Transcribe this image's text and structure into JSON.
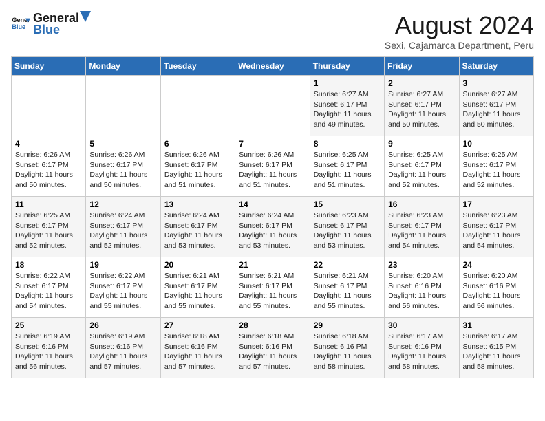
{
  "logo": {
    "line1": "General",
    "line2": "Blue"
  },
  "title": "August 2024",
  "location": "Sexi, Cajamarca Department, Peru",
  "days_of_week": [
    "Sunday",
    "Monday",
    "Tuesday",
    "Wednesday",
    "Thursday",
    "Friday",
    "Saturday"
  ],
  "weeks": [
    [
      {
        "day": "",
        "info": ""
      },
      {
        "day": "",
        "info": ""
      },
      {
        "day": "",
        "info": ""
      },
      {
        "day": "",
        "info": ""
      },
      {
        "day": "1",
        "info": "Sunrise: 6:27 AM\nSunset: 6:17 PM\nDaylight: 11 hours and 49 minutes."
      },
      {
        "day": "2",
        "info": "Sunrise: 6:27 AM\nSunset: 6:17 PM\nDaylight: 11 hours and 50 minutes."
      },
      {
        "day": "3",
        "info": "Sunrise: 6:27 AM\nSunset: 6:17 PM\nDaylight: 11 hours and 50 minutes."
      }
    ],
    [
      {
        "day": "4",
        "info": "Sunrise: 6:26 AM\nSunset: 6:17 PM\nDaylight: 11 hours and 50 minutes."
      },
      {
        "day": "5",
        "info": "Sunrise: 6:26 AM\nSunset: 6:17 PM\nDaylight: 11 hours and 50 minutes."
      },
      {
        "day": "6",
        "info": "Sunrise: 6:26 AM\nSunset: 6:17 PM\nDaylight: 11 hours and 51 minutes."
      },
      {
        "day": "7",
        "info": "Sunrise: 6:26 AM\nSunset: 6:17 PM\nDaylight: 11 hours and 51 minutes."
      },
      {
        "day": "8",
        "info": "Sunrise: 6:25 AM\nSunset: 6:17 PM\nDaylight: 11 hours and 51 minutes."
      },
      {
        "day": "9",
        "info": "Sunrise: 6:25 AM\nSunset: 6:17 PM\nDaylight: 11 hours and 52 minutes."
      },
      {
        "day": "10",
        "info": "Sunrise: 6:25 AM\nSunset: 6:17 PM\nDaylight: 11 hours and 52 minutes."
      }
    ],
    [
      {
        "day": "11",
        "info": "Sunrise: 6:25 AM\nSunset: 6:17 PM\nDaylight: 11 hours and 52 minutes."
      },
      {
        "day": "12",
        "info": "Sunrise: 6:24 AM\nSunset: 6:17 PM\nDaylight: 11 hours and 52 minutes."
      },
      {
        "day": "13",
        "info": "Sunrise: 6:24 AM\nSunset: 6:17 PM\nDaylight: 11 hours and 53 minutes."
      },
      {
        "day": "14",
        "info": "Sunrise: 6:24 AM\nSunset: 6:17 PM\nDaylight: 11 hours and 53 minutes."
      },
      {
        "day": "15",
        "info": "Sunrise: 6:23 AM\nSunset: 6:17 PM\nDaylight: 11 hours and 53 minutes."
      },
      {
        "day": "16",
        "info": "Sunrise: 6:23 AM\nSunset: 6:17 PM\nDaylight: 11 hours and 54 minutes."
      },
      {
        "day": "17",
        "info": "Sunrise: 6:23 AM\nSunset: 6:17 PM\nDaylight: 11 hours and 54 minutes."
      }
    ],
    [
      {
        "day": "18",
        "info": "Sunrise: 6:22 AM\nSunset: 6:17 PM\nDaylight: 11 hours and 54 minutes."
      },
      {
        "day": "19",
        "info": "Sunrise: 6:22 AM\nSunset: 6:17 PM\nDaylight: 11 hours and 55 minutes."
      },
      {
        "day": "20",
        "info": "Sunrise: 6:21 AM\nSunset: 6:17 PM\nDaylight: 11 hours and 55 minutes."
      },
      {
        "day": "21",
        "info": "Sunrise: 6:21 AM\nSunset: 6:17 PM\nDaylight: 11 hours and 55 minutes."
      },
      {
        "day": "22",
        "info": "Sunrise: 6:21 AM\nSunset: 6:17 PM\nDaylight: 11 hours and 55 minutes."
      },
      {
        "day": "23",
        "info": "Sunrise: 6:20 AM\nSunset: 6:16 PM\nDaylight: 11 hours and 56 minutes."
      },
      {
        "day": "24",
        "info": "Sunrise: 6:20 AM\nSunset: 6:16 PM\nDaylight: 11 hours and 56 minutes."
      }
    ],
    [
      {
        "day": "25",
        "info": "Sunrise: 6:19 AM\nSunset: 6:16 PM\nDaylight: 11 hours and 56 minutes."
      },
      {
        "day": "26",
        "info": "Sunrise: 6:19 AM\nSunset: 6:16 PM\nDaylight: 11 hours and 57 minutes."
      },
      {
        "day": "27",
        "info": "Sunrise: 6:18 AM\nSunset: 6:16 PM\nDaylight: 11 hours and 57 minutes."
      },
      {
        "day": "28",
        "info": "Sunrise: 6:18 AM\nSunset: 6:16 PM\nDaylight: 11 hours and 57 minutes."
      },
      {
        "day": "29",
        "info": "Sunrise: 6:18 AM\nSunset: 6:16 PM\nDaylight: 11 hours and 58 minutes."
      },
      {
        "day": "30",
        "info": "Sunrise: 6:17 AM\nSunset: 6:16 PM\nDaylight: 11 hours and 58 minutes."
      },
      {
        "day": "31",
        "info": "Sunrise: 6:17 AM\nSunset: 6:15 PM\nDaylight: 11 hours and 58 minutes."
      }
    ]
  ]
}
